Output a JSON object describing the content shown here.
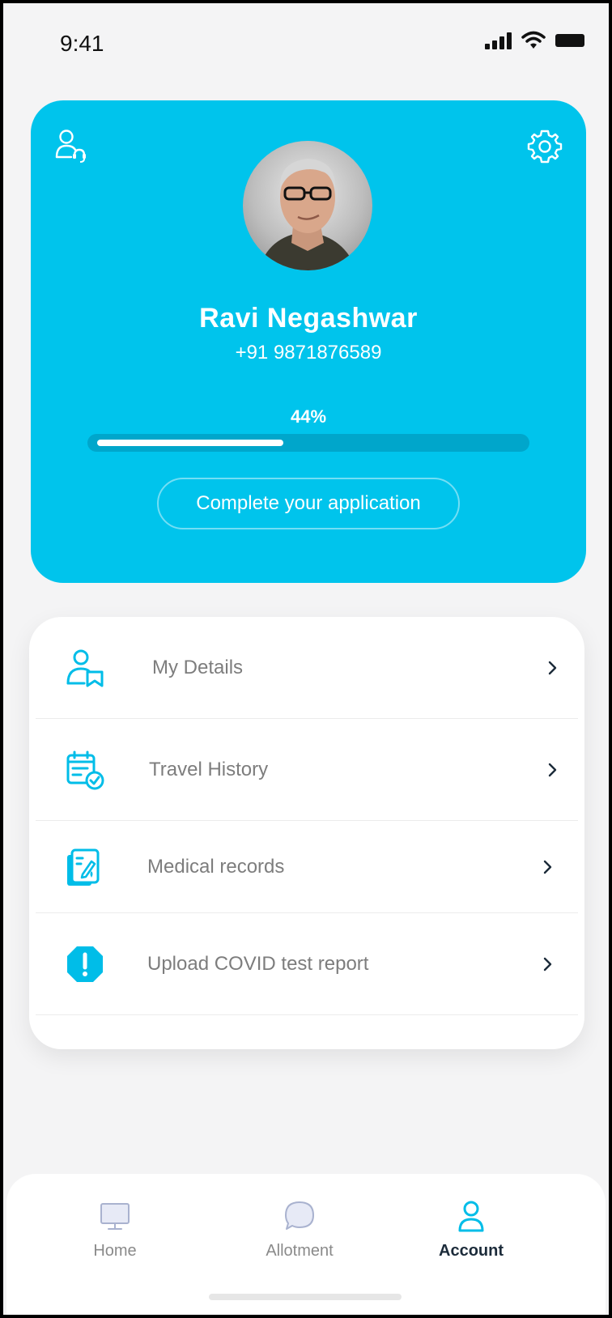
{
  "status_bar": {
    "time": "9:41"
  },
  "profile": {
    "name": "Ravi Negashwar",
    "phone": "+91 9871876589",
    "progress_label": "44%",
    "progress_fraction": 0.44,
    "cta_label": "Complete your application"
  },
  "menu": {
    "items": [
      {
        "label": "My Details",
        "icon": "user-details-icon"
      },
      {
        "label": "Travel History",
        "icon": "calendar-check-icon"
      },
      {
        "label": "Medical records",
        "icon": "medical-file-icon"
      },
      {
        "label": "Upload COVID test report",
        "icon": "alert-octagon-icon"
      }
    ]
  },
  "nav": {
    "items": [
      {
        "label": "Home",
        "icon": "monitor-icon"
      },
      {
        "label": "Allotment",
        "icon": "chat-bubble-icon"
      },
      {
        "label": "Account",
        "icon": "user-icon",
        "active": true
      }
    ]
  },
  "colors": {
    "accent": "#00c4ec",
    "track": "#00a6cb",
    "menu_icon": "#00bde8",
    "text_muted": "#7d7d7d",
    "nav_active": "#1c2b3a"
  }
}
